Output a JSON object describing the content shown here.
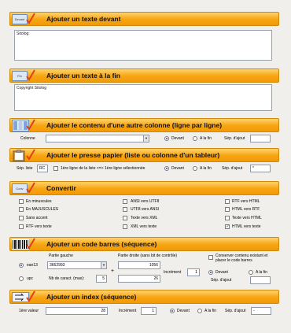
{
  "sections": {
    "devant": {
      "title": "Ajouter un texte devant",
      "icon_text": "Devant",
      "icon": "document-icon",
      "text": "Sitolog:"
    },
    "fin": {
      "title": "Ajouter un texte à la fin",
      "icon_text": "Fin",
      "icon": "document-icon",
      "text": "Copyright Sitolog"
    },
    "colonne": {
      "title": "Ajouter le contenu d'une autre colonne (ligne par ligne)",
      "icon": "columns-icon",
      "label": "Colonne",
      "value": "",
      "radio_devant": "Devant",
      "radio_fin": "A la fin",
      "sep_label": "Sép. d'ajout",
      "sep_value": ""
    },
    "presse": {
      "title": "Ajouter le presse papier (liste ou colonne d'un tableur)",
      "icon": "clipboard-icon",
      "sep_liste_label": "Sép. liste",
      "sep_liste_value": "RC",
      "checkbox_label": "1ère ligne de la liste <=> 1ère ligne sélectionnée",
      "radio_devant": "Devant",
      "radio_fin": "A la fin",
      "sep_label": "Sép. d'ajout",
      "sep_value": "*"
    },
    "convertir": {
      "title": "Convertir",
      "icon_text": "Conv",
      "icon": "convert-icon",
      "col1": [
        "En minuscules",
        "En MAJUSCULES",
        "Sans accent",
        "RTF vers texte"
      ],
      "col2": [
        "ANSI vers  UTF8",
        "UTF8 vers ANSI",
        "Texte vers XML",
        "XML vers texte"
      ],
      "col3": [
        "RTF vers HTML",
        "HTML vers RTF",
        "Texte vers HTML",
        "HTML vers texte"
      ],
      "checked": "HTML vers texte"
    },
    "barcode": {
      "title": "Ajouter un code barres (séquence)",
      "icon": "barcode-icon",
      "partie_gauche_label": "Partie gauche",
      "partie_gauche_value": "3662993",
      "partie_droite_label": "Partie droite (sans bit de contrôle)",
      "partie_droite_value": "1056",
      "radio_ean": "ean13",
      "radio_upc": "upc",
      "nb_label": "Nb de caract. (max):",
      "nb_value": "5",
      "plus_sign": "+",
      "equals_value": "26",
      "increment_label": "Incrément",
      "increment_value": "1",
      "conserver_label": "Conserver contenu existant et placer le code barres",
      "radio_devant": "Devant",
      "radio_fin": "A la fin",
      "sep_label": "Sép. d'ajout",
      "sep_value": ""
    },
    "index": {
      "title": "Ajouter un index (séquence)",
      "icon": "sequence-icon",
      "first_label": "1ère valeur",
      "first_value": "28",
      "increment_label": "Incrément",
      "increment_value": "1",
      "radio_devant": "Devant",
      "radio_fin": "A la fin",
      "sep_label": "Sép. d'ajout",
      "sep_value": "-"
    }
  },
  "colors": {
    "header_orange": "#f7a410",
    "check_red": "#e0401a",
    "radio_blue": "#1a4fa0"
  }
}
